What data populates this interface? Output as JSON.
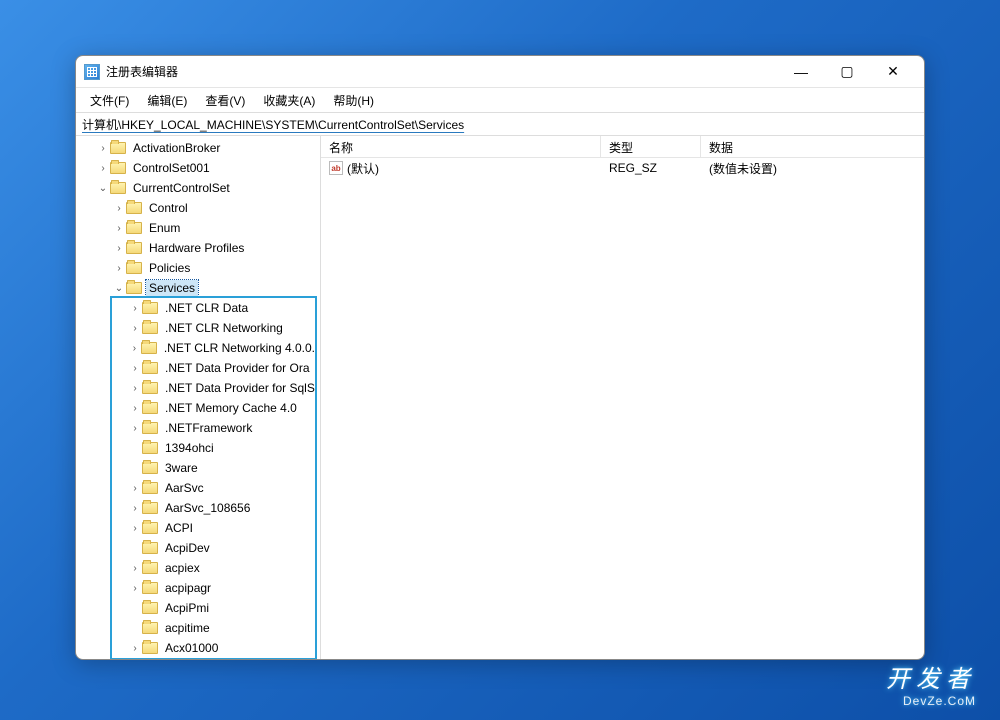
{
  "window": {
    "title": "注册表编辑器"
  },
  "menu": {
    "file": "文件(F)",
    "edit": "编辑(E)",
    "view": "查看(V)",
    "favorites": "收藏夹(A)",
    "help": "帮助(H)"
  },
  "address": {
    "path": "计算机\\HKEY_LOCAL_MACHINE\\SYSTEM\\CurrentControlSet\\Services"
  },
  "tree": [
    {
      "indent": 1,
      "exp": "›",
      "label": "ActivationBroker"
    },
    {
      "indent": 1,
      "exp": "›",
      "label": "ControlSet001"
    },
    {
      "indent": 1,
      "exp": "⌄",
      "label": "CurrentControlSet"
    },
    {
      "indent": 2,
      "exp": "›",
      "label": "Control"
    },
    {
      "indent": 2,
      "exp": "›",
      "label": "Enum"
    },
    {
      "indent": 2,
      "exp": "›",
      "label": "Hardware Profiles"
    },
    {
      "indent": 2,
      "exp": "›",
      "label": "Policies"
    },
    {
      "indent": 2,
      "exp": "⌄",
      "label": "Services",
      "selected": true
    },
    {
      "indent": 3,
      "exp": "›",
      "label": ".NET CLR Data"
    },
    {
      "indent": 3,
      "exp": "›",
      "label": ".NET CLR Networking"
    },
    {
      "indent": 3,
      "exp": "›",
      "label": ".NET CLR Networking 4.0.0."
    },
    {
      "indent": 3,
      "exp": "›",
      "label": ".NET Data Provider for Ora"
    },
    {
      "indent": 3,
      "exp": "›",
      "label": ".NET Data Provider for SqlS"
    },
    {
      "indent": 3,
      "exp": "›",
      "label": ".NET Memory Cache 4.0"
    },
    {
      "indent": 3,
      "exp": "›",
      "label": ".NETFramework"
    },
    {
      "indent": 3,
      "exp": "",
      "label": "1394ohci"
    },
    {
      "indent": 3,
      "exp": "",
      "label": "3ware"
    },
    {
      "indent": 3,
      "exp": "›",
      "label": "AarSvc"
    },
    {
      "indent": 3,
      "exp": "›",
      "label": "AarSvc_108656"
    },
    {
      "indent": 3,
      "exp": "›",
      "label": "ACPI"
    },
    {
      "indent": 3,
      "exp": "",
      "label": "AcpiDev"
    },
    {
      "indent": 3,
      "exp": "›",
      "label": "acpiex"
    },
    {
      "indent": 3,
      "exp": "›",
      "label": "acpipagr"
    },
    {
      "indent": 3,
      "exp": "",
      "label": "AcpiPmi"
    },
    {
      "indent": 3,
      "exp": "",
      "label": "acpitime"
    },
    {
      "indent": 3,
      "exp": "›",
      "label": "Acx01000"
    }
  ],
  "list": {
    "columns": {
      "name": "名称",
      "type": "类型",
      "data": "数据"
    },
    "rows": [
      {
        "icon": "ab",
        "name": "(默认)",
        "type": "REG_SZ",
        "data": "(数值未设置)"
      }
    ]
  },
  "brand": {
    "cn": "开发者",
    "en": "DevZe.CoM"
  }
}
